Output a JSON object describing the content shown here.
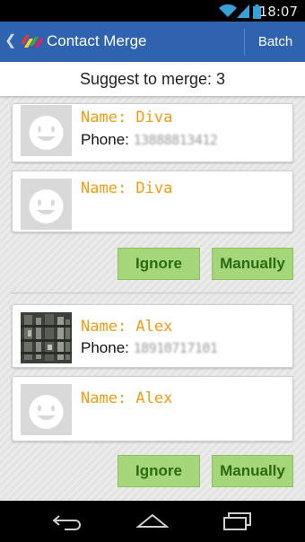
{
  "status_bar": {
    "time": "18:07"
  },
  "action_bar": {
    "back_glyph": "❮",
    "title": "Contact Merge",
    "batch_label": "Batch"
  },
  "summary": {
    "text": "Suggest to merge: 3"
  },
  "groups": [
    {
      "contacts": [
        {
          "name": "Name: Diva",
          "phone_label": "Phone: ",
          "phone": "13888813412",
          "avatar": "default-avatar"
        },
        {
          "name": "Name: Diva",
          "avatar": "default-avatar"
        }
      ],
      "ignore_label": "Ignore",
      "manual_label": "Manually"
    },
    {
      "contacts": [
        {
          "name": "Name: Alex",
          "phone_label": "Phone: ",
          "phone": "18910717101",
          "avatar": "photo-avatar"
        },
        {
          "name": "Name: Alex",
          "avatar": "default-avatar"
        }
      ],
      "ignore_label": "Ignore",
      "manual_label": "Manually"
    }
  ],
  "colors": {
    "action_bar": "#2f63b0",
    "name_text": "#f39c12",
    "button_bg": "#a6d67a",
    "button_text": "#2a6a12"
  },
  "icons": [
    "wifi-icon",
    "signal-icon",
    "battery-icon",
    "app-logo-icon",
    "back-nav-icon",
    "home-nav-icon",
    "recents-nav-icon"
  ]
}
